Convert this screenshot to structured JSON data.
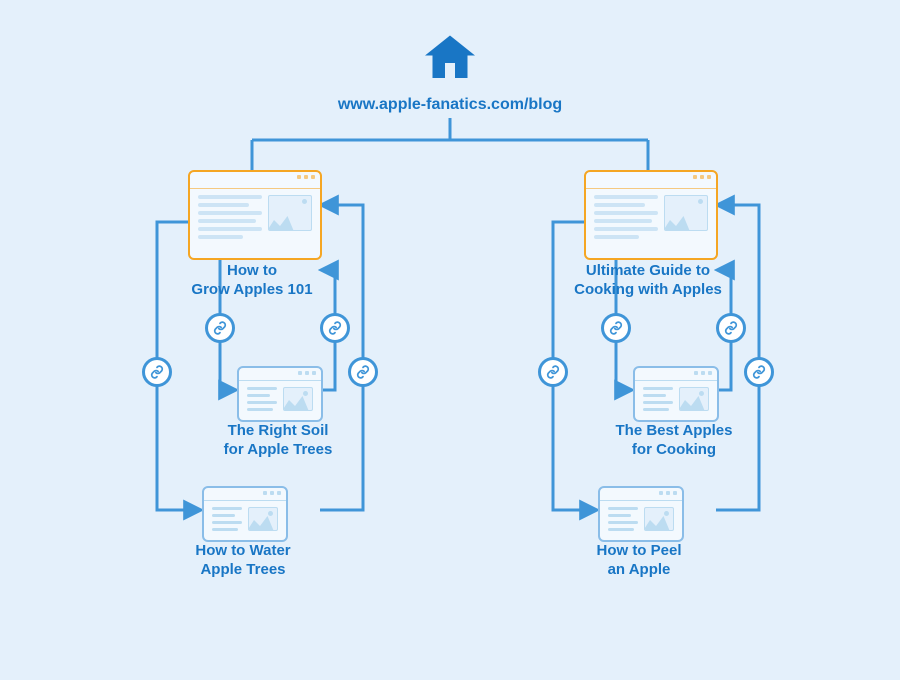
{
  "root": {
    "url": "www.apple-fanatics.com/blog"
  },
  "colors": {
    "primary": "#1976c5",
    "line": "#3f95d8",
    "pillar_border": "#f5a623",
    "bg": "#e4f0fb"
  },
  "clusters": [
    {
      "pillar": {
        "title": "How to\nGrow Apples 101"
      },
      "children": [
        {
          "title": "The Right Soil\nfor Apple Trees"
        },
        {
          "title": "How to Water\nApple Trees"
        }
      ]
    },
    {
      "pillar": {
        "title": "Ultimate Guide to\nCooking with Apples"
      },
      "children": [
        {
          "title": "The Best Apples\nfor Cooking"
        },
        {
          "title": "How to Peel\nan Apple"
        }
      ]
    }
  ]
}
